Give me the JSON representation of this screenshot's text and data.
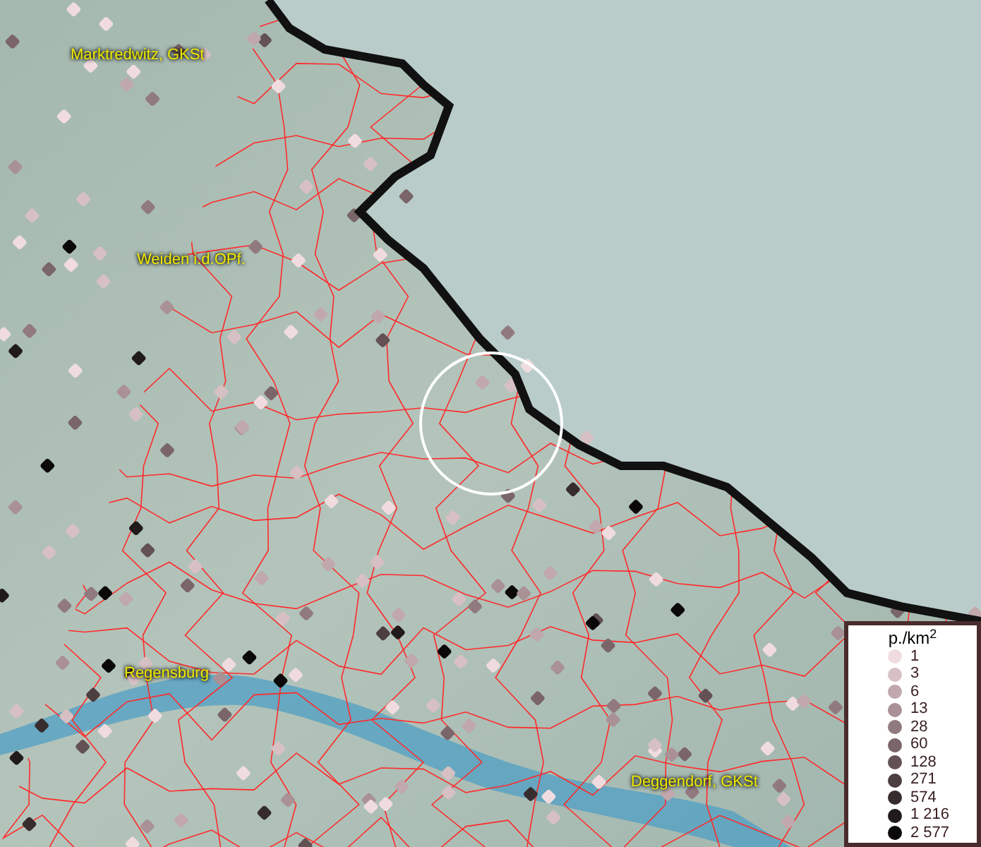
{
  "map": {
    "places": [
      {
        "name": "Marktredwitz, GKSt"
      },
      {
        "name": "Weiden i.d.OPf."
      },
      {
        "name": "Regensburg"
      },
      {
        "name": "Deggendorf, GKSt"
      }
    ]
  },
  "legend": {
    "title": "p./km$^{2}$",
    "entries": [
      {
        "label": "1",
        "color": "#f0dcdf"
      },
      {
        "label": "3",
        "color": "#d7c0c3"
      },
      {
        "label": "6",
        "color": "#c0a8ac"
      },
      {
        "label": "13",
        "color": "#a99195"
      },
      {
        "label": "28",
        "color": "#917a7e"
      },
      {
        "label": "60",
        "color": "#7a6568"
      },
      {
        "label": "128",
        "color": "#635154"
      },
      {
        "label": "271",
        "color": "#4d3e40"
      },
      {
        "label": "574",
        "color": "#362b2d"
      },
      {
        "label": "1 216",
        "color": "#211a1b"
      },
      {
        "label": "2 577",
        "color": "#0a0808"
      }
    ]
  }
}
